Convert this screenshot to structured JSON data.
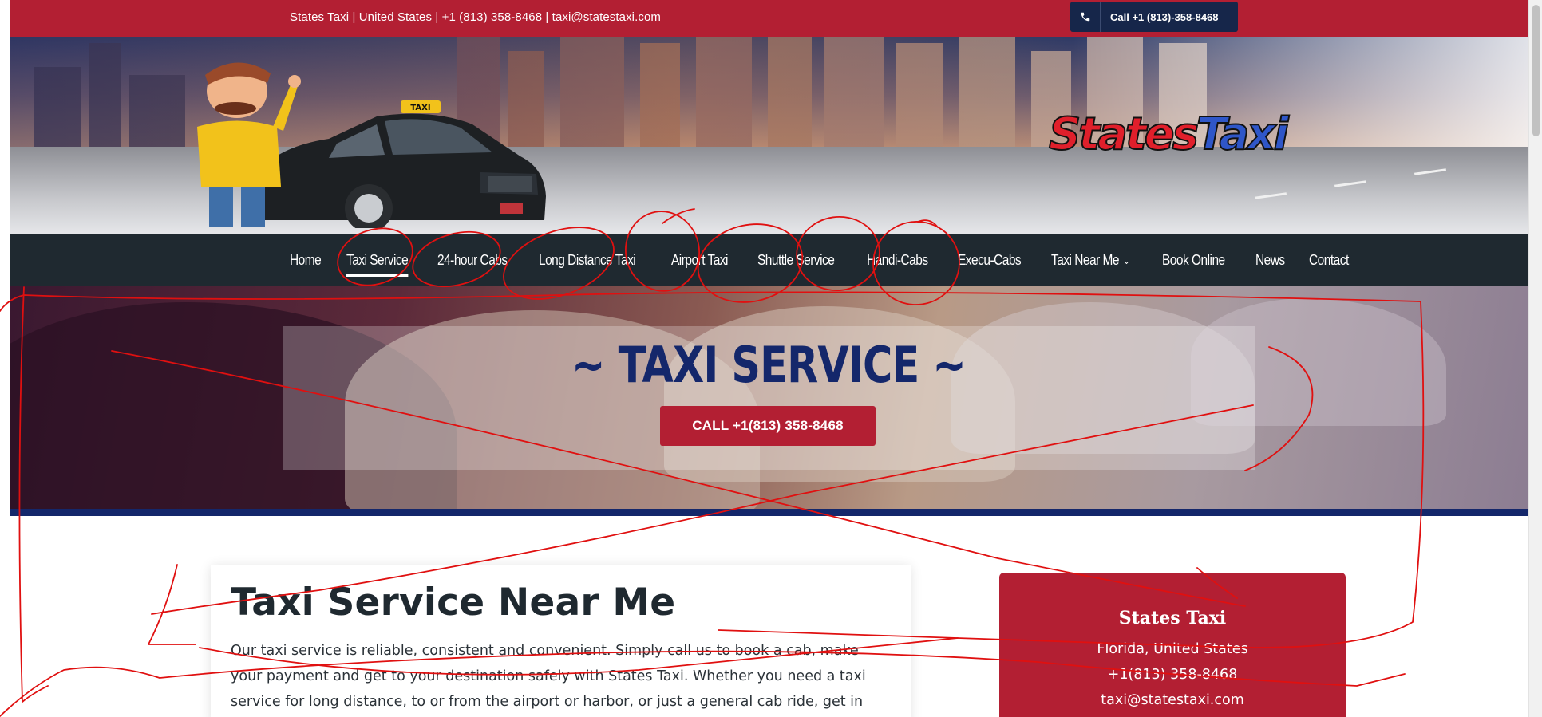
{
  "topbar": {
    "info": "States Taxi | United States | +1 (813) 358-8468  |  taxi@statestaxi.com",
    "call_button": "Call +1 (813)-358-8468",
    "phone_icon": "phone-icon"
  },
  "header": {
    "logo_part1": "States",
    "logo_part2": "Taxi",
    "mascot": "cartoon-driver-mascot",
    "taxi_sign": "TAXI"
  },
  "nav": {
    "items": [
      {
        "label": "Home"
      },
      {
        "label": "Taxi Service",
        "active": true
      },
      {
        "label": "24-hour Cabs"
      },
      {
        "label": "Long Distance Taxi"
      },
      {
        "label": "Airport Taxi"
      },
      {
        "label": "Shuttle Service"
      },
      {
        "label": "Handi-Cabs"
      },
      {
        "label": "Execu-Cabs"
      },
      {
        "label": "Taxi Near Me",
        "dropdown": true
      },
      {
        "label": "Book Online"
      },
      {
        "label": "News"
      },
      {
        "label": "Contact"
      }
    ]
  },
  "hero": {
    "title": "~ TAXI SERVICE ~",
    "button": "CALL +1(813) 358-8468"
  },
  "main": {
    "heading": "Taxi Service Near Me",
    "paragraph": "Our taxi service is reliable, consistent and convenient. Simply call us to book a cab, make your payment and get to your destination safely with States Taxi. Whether you need a taxi service for long distance, to or from the airport or harbor, or just a general cab ride, get in touch for a taxi."
  },
  "sidebar_card": {
    "title": "States Taxi",
    "location": "Florida, United States",
    "phone": "+1(813) 358-8468",
    "email": "taxi@statestaxi.com"
  },
  "colors": {
    "brand_red": "#b31f33",
    "nav_dark": "#1f2930",
    "navy": "#14276b",
    "annotation_red": "#e01010"
  }
}
